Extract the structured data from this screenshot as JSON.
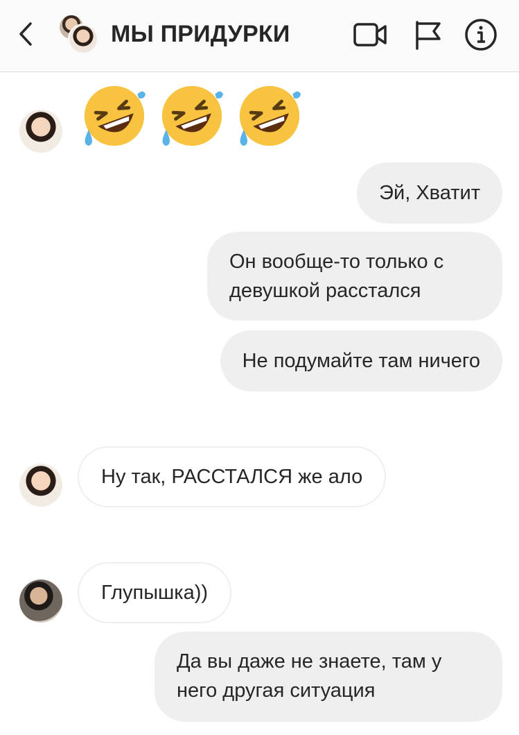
{
  "header": {
    "title": "МЫ ПРИДУРКИ",
    "icons": [
      "back-chevron-icon",
      "video-call-icon",
      "report-flag-icon",
      "info-icon"
    ]
  },
  "messages": [
    {
      "side": "in",
      "sender_avatar": "jin",
      "type": "emoji",
      "content": "🤣🤣🤣"
    },
    {
      "side": "out",
      "type": "text",
      "content": "Эй, Хватит"
    },
    {
      "side": "out",
      "type": "text",
      "content_line1": "Он вообще-то только с",
      "content_line2": "девушкой расстался"
    },
    {
      "side": "out",
      "type": "text",
      "content": "Не подумайте там ничего"
    },
    {
      "side": "in",
      "sender_avatar": "jin",
      "type": "text",
      "content": "Ну так, РАССТАЛСЯ же ало"
    },
    {
      "side": "in",
      "sender_avatar": "rm",
      "type": "text",
      "content": "Глупышка))"
    },
    {
      "side": "out",
      "type": "text",
      "content_line1": "Да вы даже не знаете, там у",
      "content_line2": "него другая ситуация"
    }
  ],
  "colors": {
    "header_bg": "#fafafa",
    "outgoing_bubble": "#efefef",
    "incoming_border": "#efefef",
    "text": "#262626"
  }
}
